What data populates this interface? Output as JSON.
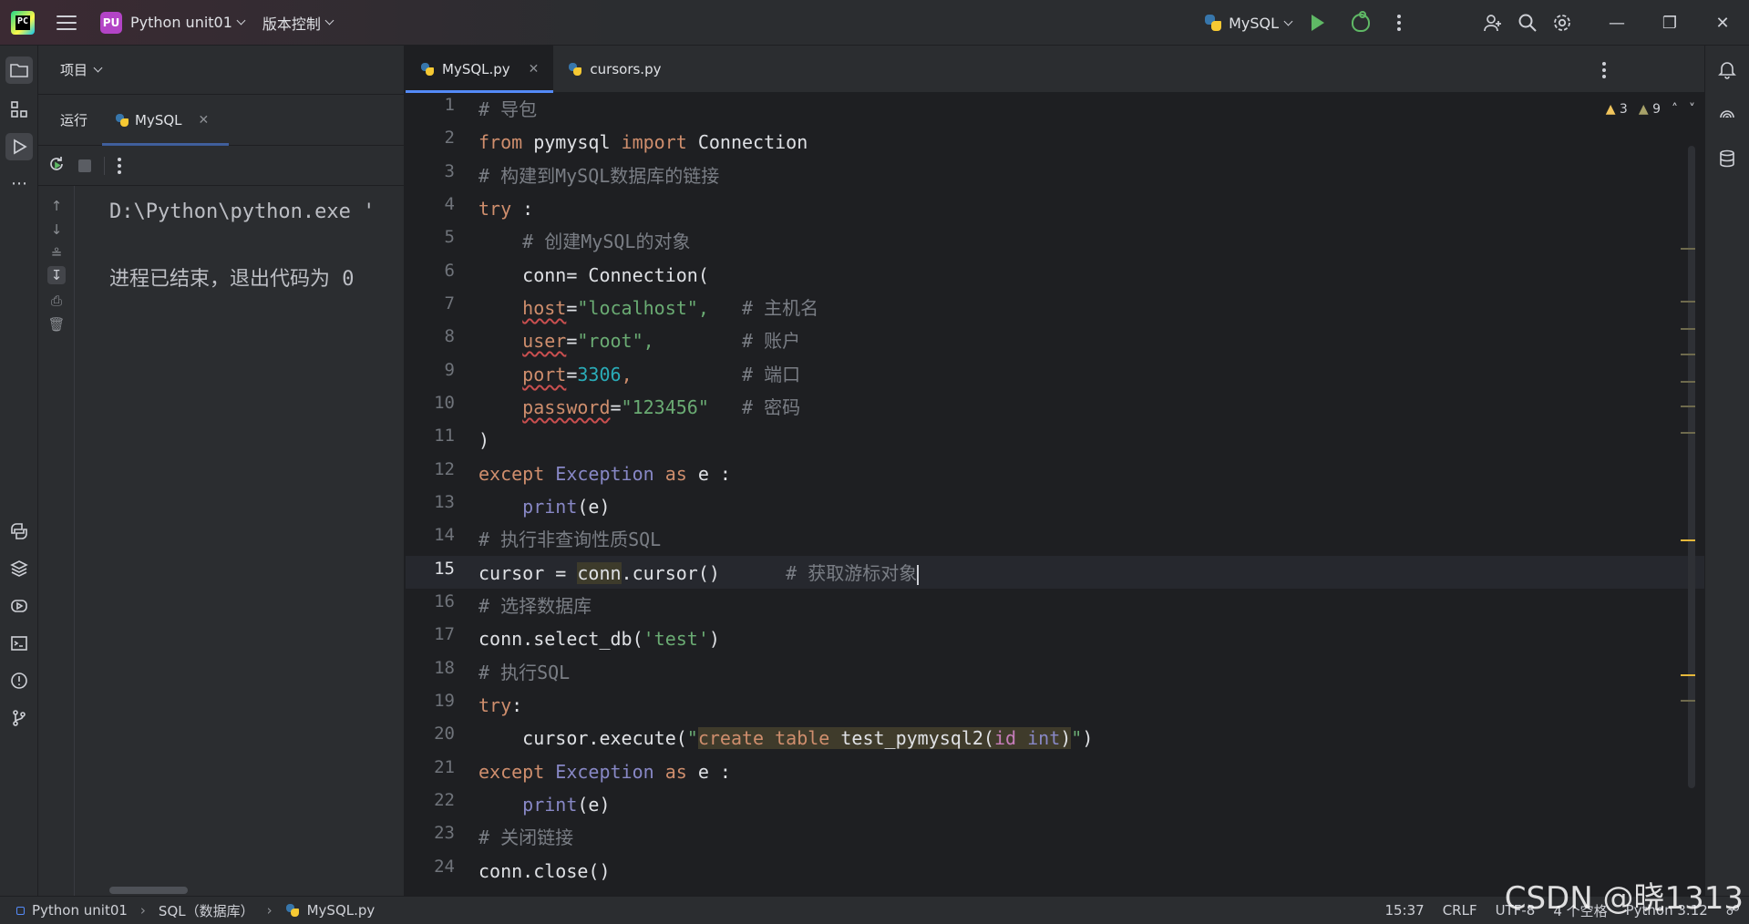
{
  "titlebar": {
    "project_badge": "PU",
    "project_name": "Python unit01",
    "vcs_menu": "版本控制",
    "run_config": "MySQL"
  },
  "run_panel": {
    "header": "项目",
    "tab_group": "运行",
    "run_tab": "MySQL",
    "console_lines": [
      "D:\\Python\\python.exe '",
      "进程已结束，退出代码为 0"
    ]
  },
  "editor": {
    "tabs": [
      {
        "label": "MySQL.py",
        "active": true
      },
      {
        "label": "cursors.py",
        "active": false
      }
    ],
    "inspections": {
      "warnings": "3",
      "weak_warnings": "9"
    },
    "current_line": 15,
    "line_numbers": [
      "1",
      "2",
      "3",
      "4",
      "5",
      "6",
      "7",
      "8",
      "9",
      "10",
      "11",
      "12",
      "13",
      "14",
      "15",
      "16",
      "17",
      "18",
      "19",
      "20",
      "21",
      "22",
      "23",
      "24"
    ],
    "code": {
      "l1": "# 导包",
      "l2_kw1": "from",
      "l2_mod": " pymysql ",
      "l2_kw2": "import",
      "l2_cls": " Connection",
      "l3": "# 构建到MySQL数据库的链接",
      "l4_kw": "try",
      "l4_rest": " :",
      "l5": "    # 创建MySQL的对象",
      "l6": "    conn= Connection(",
      "l7_param": "host",
      "l7_eq": "=",
      "l7_str": "\"localhost\",",
      "l7_cm": "   # 主机名",
      "l8_param": "user",
      "l8_eq": "=",
      "l8_str": "\"root\",",
      "l8_cm": "        # 账户",
      "l9_param": "port",
      "l9_eq": "=",
      "l9_num": "3306",
      "l9_rest": ",",
      "l9_cm": "          # 端口",
      "l10_param": "password",
      "l10_eq": "=",
      "l10_str": "\"123456\"",
      "l10_cm": "   # 密码",
      "l11": ")",
      "l12_kw1": "except",
      "l12_cls": " Exception ",
      "l12_kw2": "as",
      "l12_rest": " e :",
      "l13_fn": "    print",
      "l13_rest": "(e)",
      "l14": "# 执行非查询性质SQL",
      "l15_a": "cursor = ",
      "l15_conn": "conn",
      "l15_b": ".cursor()",
      "l15_cm": "      # 获取游标对象",
      "l16": "# 选择数据库",
      "l17_a": "conn.select_db(",
      "l17_str": "'test'",
      "l17_b": ")",
      "l18": "# 执行SQL",
      "l19_kw": "try",
      "l19_rest": ":",
      "l20_a": "    cursor.execute(",
      "l20_q1": "\"",
      "l20_k1": "create",
      "l20_sp1": " ",
      "l20_k2": "table",
      "l20_t": " test_pymysql2(",
      "l20_id": "id",
      "l20_sp2": " ",
      "l20_k3": "int",
      "l20_close": ")",
      "l20_q2": "\"",
      "l20_b": ")",
      "l21_kw1": "except",
      "l21_cls": " Exception ",
      "l21_kw2": "as",
      "l21_rest": " e :",
      "l22_fn": "    print",
      "l22_rest": "(e)",
      "l23": "# 关闭链接",
      "l24": "conn.close()"
    }
  },
  "statusbar": {
    "breadcrumb": [
      "Python unit01",
      "SQL（数据库）",
      "MySQL.py"
    ],
    "position": "15:37",
    "line_sep": "CRLF",
    "encoding": "UTF-8",
    "indent": "4 个空格",
    "interpreter": "Python 3.12"
  },
  "watermark": "CSDN @晓1313",
  "colors": {
    "accent": "#548af7",
    "run_green": "#5fb865",
    "keyword": "#cf8e6d",
    "string": "#6aab73",
    "comment": "#7a7e85"
  }
}
